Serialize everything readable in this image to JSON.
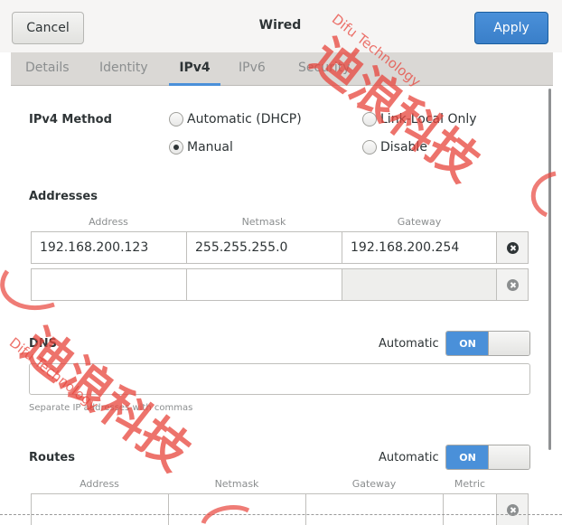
{
  "header": {
    "cancel_label": "Cancel",
    "title": "Wired",
    "apply_label": "Apply"
  },
  "tabs": [
    {
      "label": "Details"
    },
    {
      "label": "Identity"
    },
    {
      "label": "IPv4",
      "active": true
    },
    {
      "label": "IPv6"
    },
    {
      "label": "Security"
    }
  ],
  "ipv4_method": {
    "label": "IPv4 Method",
    "options": [
      {
        "label": "Automatic (DHCP)",
        "selected": false
      },
      {
        "label": "Link-Local Only",
        "selected": false
      },
      {
        "label": "Manual",
        "selected": true
      },
      {
        "label": "Disable",
        "selected": false
      }
    ]
  },
  "addresses": {
    "label": "Addresses",
    "columns": [
      "Address",
      "Netmask",
      "Gateway"
    ],
    "rows": [
      {
        "address": "192.168.200.123",
        "netmask": "255.255.255.0",
        "gateway": "192.168.200.254"
      },
      {
        "address": "",
        "netmask": "",
        "gateway": ""
      }
    ]
  },
  "dns": {
    "label": "DNS",
    "automatic_label": "Automatic",
    "switch_label": "ON",
    "value": "",
    "hint": "Separate IP addresses with commas"
  },
  "routes": {
    "label": "Routes",
    "automatic_label": "Automatic",
    "switch_label": "ON",
    "columns": [
      "Address",
      "Netmask",
      "Gateway",
      "Metric"
    ]
  },
  "watermark": {
    "chinese": "迪浪科技",
    "latin": "Difu Technology",
    "color": "#e8453c"
  },
  "colors": {
    "accent": "#4a90d9",
    "tab_bar": "#dad8d5"
  }
}
